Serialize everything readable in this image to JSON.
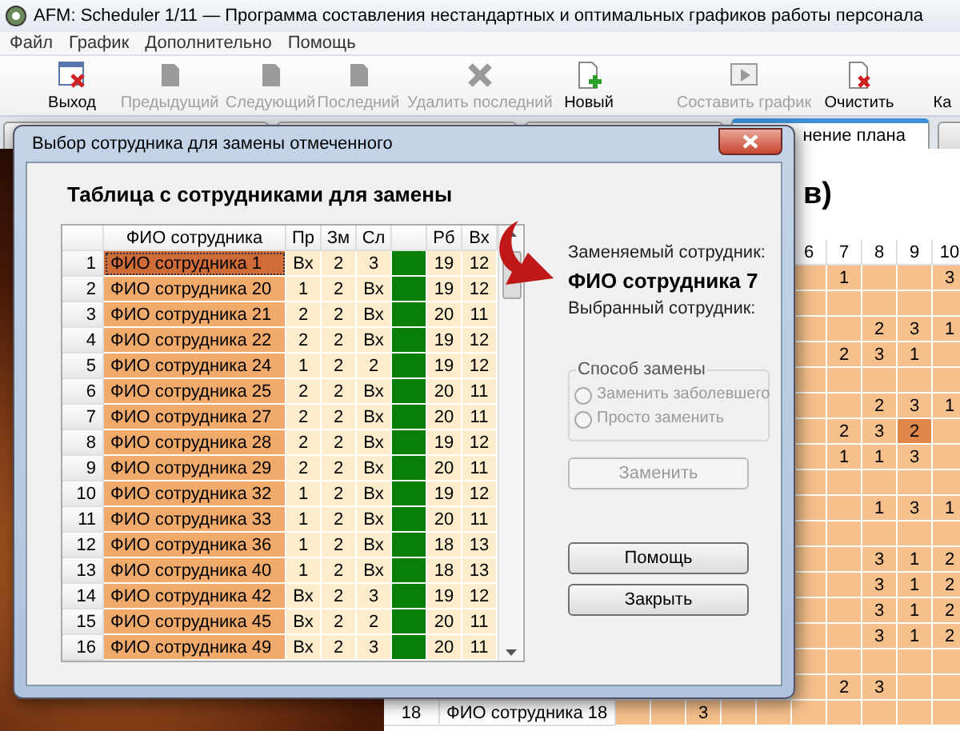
{
  "window": {
    "title": "AFM: Scheduler 1/11 — Программа составления  нестандартных и оптимальных графиков работы персонала"
  },
  "menu": [
    "Файл",
    "График",
    "Дополнительно",
    "Помощь"
  ],
  "toolbar": [
    {
      "kind": "exit",
      "label": "Выход",
      "disabled": false
    },
    {
      "kind": "prev",
      "label": "Предыдущий",
      "disabled": true
    },
    {
      "kind": "next",
      "label": "Следующий",
      "disabled": true
    },
    {
      "kind": "last",
      "label": "Последний",
      "disabled": true
    },
    {
      "kind": "delete",
      "label": "Удалить последний",
      "disabled": true
    },
    {
      "kind": "new",
      "label": "Новый",
      "disabled": false
    },
    {
      "kind": "build",
      "label": "Составить график",
      "disabled": true
    },
    {
      "kind": "clear",
      "label": "Очистить",
      "disabled": false
    },
    {
      "kind": "cut",
      "label": "Ка"
    }
  ],
  "tabs": [
    {
      "selected": false
    },
    {
      "selected": false
    },
    {
      "selected": false
    },
    {
      "label": "нение плана",
      "selected": true
    },
    {
      "selected": false
    }
  ],
  "schedule": {
    "heading": "в)",
    "columns": [
      "6",
      "7",
      "8",
      "9",
      "10"
    ],
    "rows": [
      {
        "days": [
          {
            "selected": false
          },
          {
            "text": "1",
            "selected": false
          },
          {
            "selected": false
          },
          {
            "selected": false
          },
          {
            "text": "3",
            "selected": false
          }
        ]
      },
      {
        "days": [
          {
            "selected": false
          },
          {
            "selected": false
          },
          {
            "selected": false
          },
          {
            "selected": false
          },
          {
            "selected": false
          }
        ]
      },
      {
        "days": [
          {
            "selected": false
          },
          {
            "selected": false
          },
          {
            "text": "2",
            "selected": false
          },
          {
            "text": "3",
            "selected": false
          },
          {
            "text": "1",
            "selected": false
          }
        ]
      },
      {
        "days": [
          {
            "selected": false
          },
          {
            "text": "2",
            "selected": false
          },
          {
            "text": "3",
            "selected": false
          },
          {
            "text": "1",
            "selected": false
          },
          {
            "selected": false
          }
        ]
      },
      {
        "days": [
          {
            "selected": false
          },
          {
            "selected": false
          },
          {
            "selected": false
          },
          {
            "selected": false
          },
          {
            "selected": false
          }
        ]
      },
      {
        "days": [
          {
            "selected": false
          },
          {
            "selected": false
          },
          {
            "text": "2",
            "selected": false
          },
          {
            "text": "3",
            "selected": false
          },
          {
            "text": "1",
            "selected": false
          }
        ]
      },
      {
        "days": [
          {
            "selected": false
          },
          {
            "text": "2",
            "selected": false
          },
          {
            "text": "3",
            "selected": false
          },
          {
            "text": "2",
            "selected": true
          },
          {
            "selected": false
          }
        ]
      },
      {
        "days": [
          {
            "selected": false
          },
          {
            "text": "1",
            "selected": false
          },
          {
            "text": "1",
            "selected": false
          },
          {
            "text": "3",
            "selected": false
          },
          {
            "selected": false
          }
        ]
      },
      {
        "days": [
          {
            "selected": false
          },
          {
            "selected": false
          },
          {
            "selected": false
          },
          {
            "selected": false
          },
          {
            "selected": false
          }
        ]
      },
      {
        "days": [
          {
            "selected": false
          },
          {
            "selected": false
          },
          {
            "text": "1",
            "selected": false
          },
          {
            "text": "3",
            "selected": false
          },
          {
            "text": "1",
            "selected": false
          }
        ]
      },
      {
        "days": [
          {
            "selected": false
          },
          {
            "selected": false
          },
          {
            "selected": false
          },
          {
            "selected": false
          },
          {
            "selected": false
          }
        ]
      },
      {
        "days": [
          {
            "selected": false
          },
          {
            "selected": false
          },
          {
            "text": "3",
            "selected": false
          },
          {
            "text": "1",
            "selected": false
          },
          {
            "text": "2",
            "selected": false
          }
        ]
      },
      {
        "days": [
          {
            "selected": false
          },
          {
            "selected": false
          },
          {
            "text": "3",
            "selected": false
          },
          {
            "text": "1",
            "selected": false
          },
          {
            "text": "2",
            "selected": false
          }
        ]
      },
      {
        "days": [
          {
            "selected": false
          },
          {
            "selected": false
          },
          {
            "text": "3",
            "selected": false
          },
          {
            "text": "1",
            "selected": false
          },
          {
            "text": "2",
            "selected": false
          }
        ]
      },
      {
        "days": [
          {
            "selected": false
          },
          {
            "selected": false
          },
          {
            "text": "3",
            "selected": false
          },
          {
            "text": "1",
            "selected": false
          },
          {
            "text": "2",
            "selected": false
          }
        ]
      },
      {
        "days": [
          {
            "selected": false
          },
          {
            "selected": false
          },
          {
            "selected": false
          },
          {
            "selected": false
          },
          {
            "selected": false
          }
        ]
      },
      {
        "days": [
          {
            "selected": false
          },
          {
            "text": "2",
            "selected": false
          },
          {
            "text": "3",
            "selected": false
          },
          {
            "selected": false
          },
          {
            "selected": false
          }
        ]
      }
    ],
    "last_row": {
      "number": "18",
      "name": "ФИО сотрудника 18",
      "days": [
        {
          "selected": false
        },
        {
          "selected": false
        },
        {
          "text": "3",
          "selected": false
        },
        {
          "selected": false
        },
        {
          "selected": false
        },
        {
          "selected": false
        },
        {
          "selected": false
        },
        {
          "selected": false
        },
        {
          "selected": false
        },
        {
          "selected": false
        }
      ]
    }
  },
  "dialog": {
    "title": "Выбор сотрудника для замены отмеченного",
    "table_title": "Таблица с сотрудниками для замены",
    "columns": [
      "ФИО сотрудника",
      "Пр",
      "Зм",
      "Сл",
      "Рб",
      "Вх"
    ],
    "rows": [
      {
        "number": "1",
        "cells": [
          "ФИО сотрудника 1",
          "Вх",
          "2",
          "3",
          "19",
          "12"
        ],
        "color": "#088008",
        "selected": true
      },
      {
        "number": "2",
        "cells": [
          "ФИО сотрудника 20",
          "1",
          "2",
          "Вх",
          "19",
          "12"
        ],
        "color": "#088008",
        "selected": false
      },
      {
        "number": "3",
        "cells": [
          "ФИО сотрудника 21",
          "2",
          "2",
          "Вх",
          "20",
          "11"
        ],
        "color": "#088008",
        "selected": false
      },
      {
        "number": "4",
        "cells": [
          "ФИО сотрудника 22",
          "2",
          "2",
          "Вх",
          "19",
          "12"
        ],
        "color": "#088008",
        "selected": false
      },
      {
        "number": "5",
        "cells": [
          "ФИО сотрудника 24",
          "1",
          "2",
          "2",
          "19",
          "12"
        ],
        "color": "#088008",
        "selected": false
      },
      {
        "number": "6",
        "cells": [
          "ФИО сотрудника 25",
          "2",
          "2",
          "Вх",
          "20",
          "11"
        ],
        "color": "#088008",
        "selected": false
      },
      {
        "number": "7",
        "cells": [
          "ФИО сотрудника 27",
          "2",
          "2",
          "Вх",
          "20",
          "11"
        ],
        "color": "#088008",
        "selected": false
      },
      {
        "number": "8",
        "cells": [
          "ФИО сотрудника 28",
          "2",
          "2",
          "Вх",
          "19",
          "12"
        ],
        "color": "#088008",
        "selected": false
      },
      {
        "number": "9",
        "cells": [
          "ФИО сотрудника 29",
          "2",
          "2",
          "Вх",
          "20",
          "11"
        ],
        "color": "#088008",
        "selected": false
      },
      {
        "number": "10",
        "cells": [
          "ФИО сотрудника 32",
          "1",
          "2",
          "Вх",
          "19",
          "12"
        ],
        "color": "#088008",
        "selected": false
      },
      {
        "number": "11",
        "cells": [
          "ФИО сотрудника 33",
          "1",
          "2",
          "Вх",
          "20",
          "11"
        ],
        "color": "#088008",
        "selected": false
      },
      {
        "number": "12",
        "cells": [
          "ФИО сотрудника 36",
          "1",
          "2",
          "Вх",
          "18",
          "13"
        ],
        "color": "#088008",
        "selected": false
      },
      {
        "number": "13",
        "cells": [
          "ФИО сотрудника 40",
          "1",
          "2",
          "Вх",
          "18",
          "13"
        ],
        "color": "#088008",
        "selected": false
      },
      {
        "number": "14",
        "cells": [
          "ФИО сотрудника 42",
          "Вх",
          "2",
          "3",
          "19",
          "12"
        ],
        "color": "#088008",
        "selected": false
      },
      {
        "number": "15",
        "cells": [
          "ФИО сотрудника 45",
          "Вх",
          "2",
          "2",
          "20",
          "11"
        ],
        "color": "#088008",
        "selected": false
      },
      {
        "number": "16",
        "cells": [
          "ФИО сотрудника 49",
          "Вх",
          "2",
          "3",
          "20",
          "11"
        ],
        "color": "#088008",
        "selected": false
      }
    ],
    "replaced_label": "Заменяемый сотрудник:",
    "replaced_name": "ФИО сотрудника 7",
    "chosen_label": "Выбранный сотрудник:",
    "method": {
      "title": "Способ замены",
      "options": [
        {
          "label": "Заменить заболевшего",
          "selected": false,
          "disabled": true
        },
        {
          "label": "Просто заменить",
          "selected": false,
          "disabled": true
        }
      ]
    },
    "replace_button": {
      "label": "Заменить",
      "disabled": true
    },
    "buttons": [
      {
        "label": "Помощь",
        "disabled": false
      },
      {
        "label": "Закрыть",
        "disabled": false
      }
    ]
  }
}
